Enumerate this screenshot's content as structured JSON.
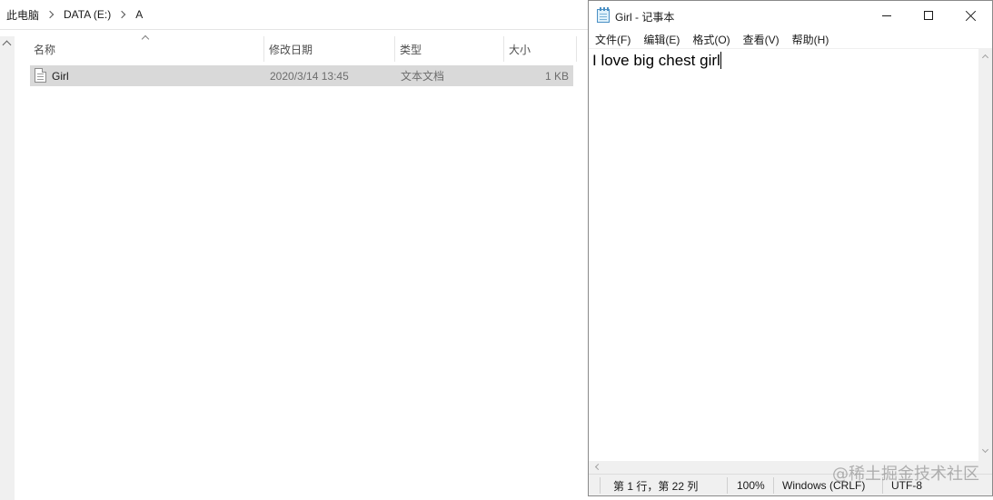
{
  "explorer": {
    "breadcrumb": [
      "此电脑",
      "DATA (E:)",
      "A"
    ],
    "columns": {
      "name": "名称",
      "modified": "修改日期",
      "type": "类型",
      "size": "大小"
    },
    "files": [
      {
        "name": "Girl",
        "modified": "2020/3/14 13:45",
        "type": "文本文档",
        "size": "1 KB",
        "icon": "text-document-icon"
      }
    ]
  },
  "notepad": {
    "title": "Girl - 记事本",
    "menu": [
      "文件(F)",
      "编辑(E)",
      "格式(O)",
      "查看(V)",
      "帮助(H)"
    ],
    "content": "I love big chest girl",
    "status": {
      "position": "第 1 行，第 22 列",
      "zoom": "100%",
      "line_ending": "Windows (CRLF)",
      "encoding": "UTF-8"
    }
  },
  "watermark": "@稀土掘金技术社区",
  "colors": {
    "selection": "#d9d9d9",
    "border": "#8a8a8a",
    "statusbar": "#f0f0f0"
  }
}
